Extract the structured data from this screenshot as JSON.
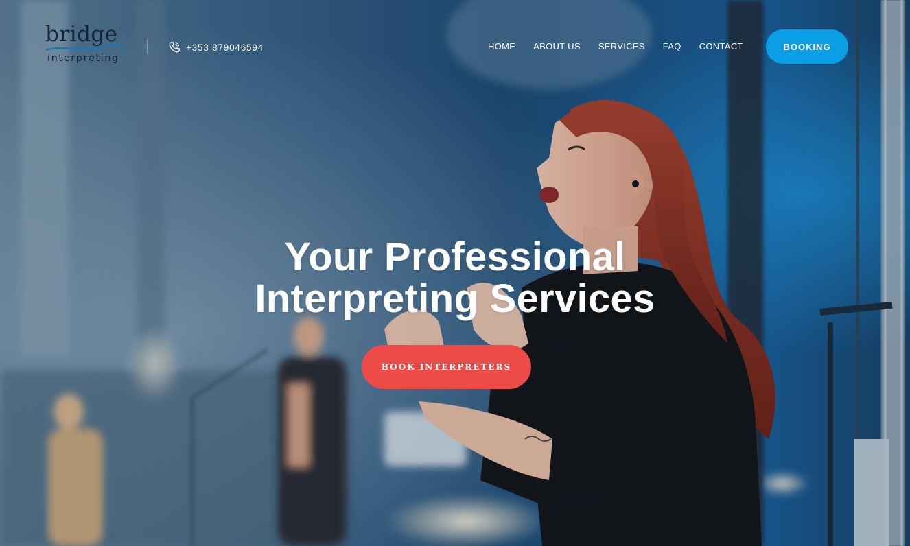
{
  "logo": {
    "word": "bridge",
    "sub": "interpreting"
  },
  "header": {
    "phone": "+353 879046594",
    "booking_label": "BOOKING"
  },
  "nav": {
    "items": [
      {
        "label": "HOME"
      },
      {
        "label": "ABOUT US"
      },
      {
        "label": "SERVICES"
      },
      {
        "label": "FAQ"
      },
      {
        "label": "CONTACT"
      }
    ]
  },
  "hero": {
    "headline_line1": "Your Professional",
    "headline_line2": "Interpreting Services",
    "cta_label": "BOOK INTERPRETERS"
  },
  "colors": {
    "booking_button": "#0a9ee6",
    "cta_button": "#ec4b47",
    "logo_text": "#14243a",
    "logo_wave": "#1f73b8"
  },
  "icons": {
    "phone": "phone-icon"
  }
}
